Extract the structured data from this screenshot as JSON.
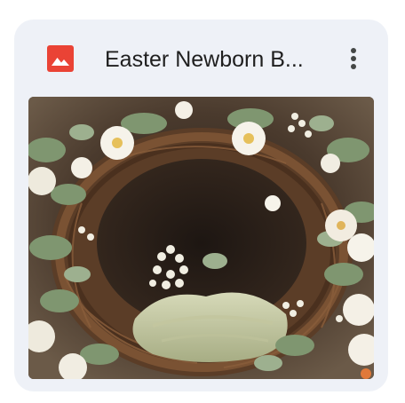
{
  "card": {
    "file_type_icon": "image-icon",
    "title": "Easter Newborn B...",
    "menu_icon": "more-vert-icon",
    "thumbnail": "wreath-photo"
  },
  "colors": {
    "card_background": "#eef1f7",
    "file_icon_red": "#ea4335",
    "title_text": "#1f1f1f",
    "menu_icon": "#444746"
  }
}
